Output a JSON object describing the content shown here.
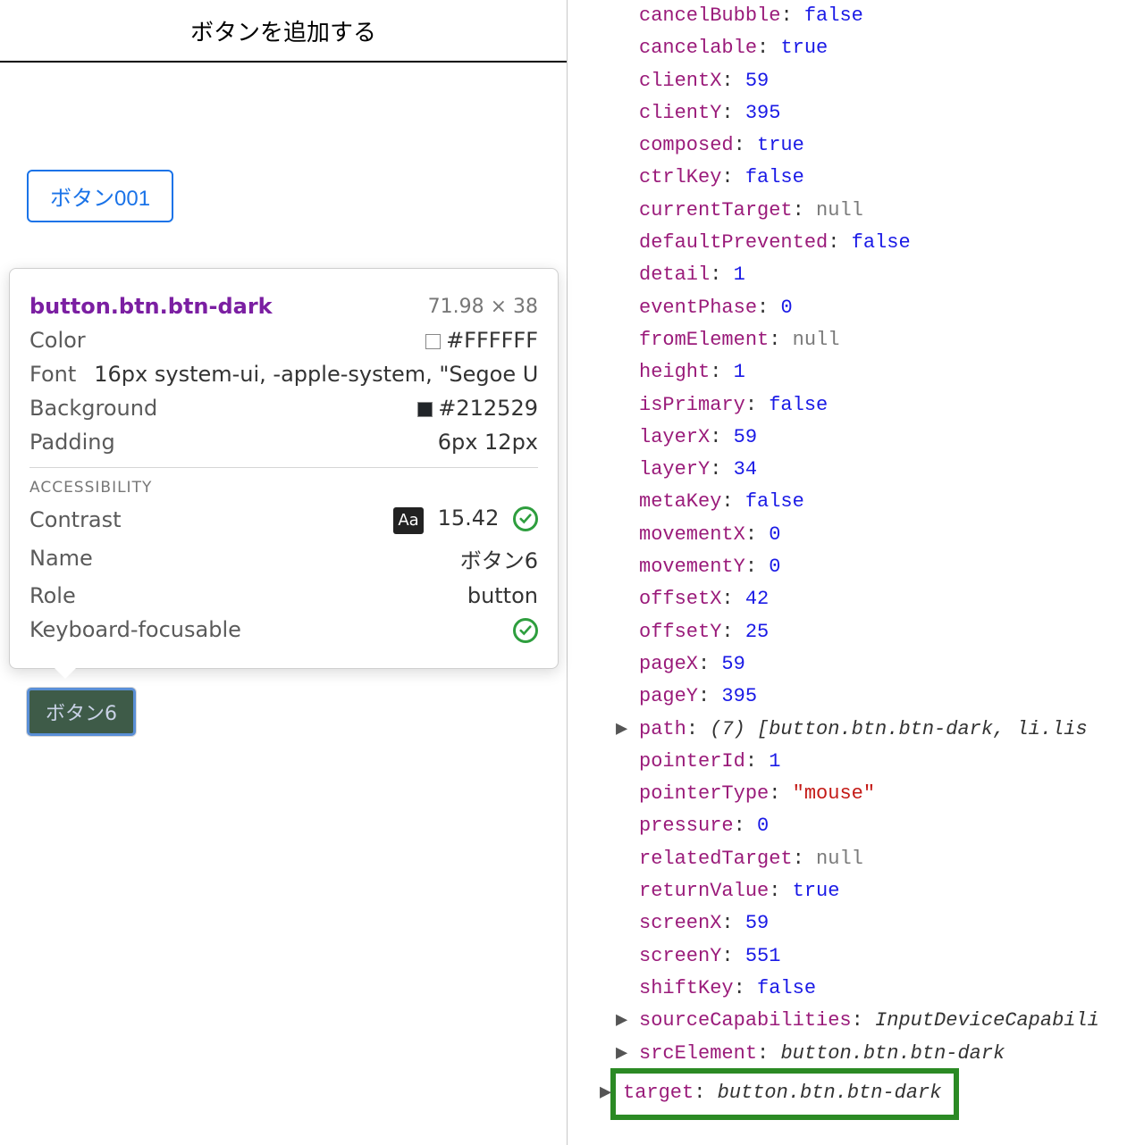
{
  "header": {
    "title": "ボタンを追加する"
  },
  "buttons": {
    "outline_label": "ボタン001",
    "dark_label": "ボタン6"
  },
  "inspector": {
    "selector": "button.btn.btn-dark",
    "dimensions": "71.98 × 38",
    "color_label": "Color",
    "color_value": "#FFFFFF",
    "font_label": "Font",
    "font_value": "16px system-ui, -apple-system, \"Segoe U...",
    "bg_label": "Background",
    "bg_value": "#212529",
    "padding_label": "Padding",
    "padding_value": "6px 12px",
    "a11y_title": "ACCESSIBILITY",
    "contrast_label": "Contrast",
    "contrast_badge": "Aa",
    "contrast_value": "15.42",
    "name_label": "Name",
    "name_value": "ボタン6",
    "role_label": "Role",
    "role_value": "button",
    "kb_label": "Keyboard-focusable"
  },
  "console": {
    "lines": [
      {
        "key": "cancelBubble",
        "val": "false",
        "type": "bool"
      },
      {
        "key": "cancelable",
        "val": "true",
        "type": "bool"
      },
      {
        "key": "clientX",
        "val": "59",
        "type": "num"
      },
      {
        "key": "clientY",
        "val": "395",
        "type": "num"
      },
      {
        "key": "composed",
        "val": "true",
        "type": "bool"
      },
      {
        "key": "ctrlKey",
        "val": "false",
        "type": "bool"
      },
      {
        "key": "currentTarget",
        "val": "null",
        "type": "null"
      },
      {
        "key": "defaultPrevented",
        "val": "false",
        "type": "bool"
      },
      {
        "key": "detail",
        "val": "1",
        "type": "num"
      },
      {
        "key": "eventPhase",
        "val": "0",
        "type": "num"
      },
      {
        "key": "fromElement",
        "val": "null",
        "type": "null"
      },
      {
        "key": "height",
        "val": "1",
        "type": "num"
      },
      {
        "key": "isPrimary",
        "val": "false",
        "type": "bool"
      },
      {
        "key": "layerX",
        "val": "59",
        "type": "num"
      },
      {
        "key": "layerY",
        "val": "34",
        "type": "num"
      },
      {
        "key": "metaKey",
        "val": "false",
        "type": "bool"
      },
      {
        "key": "movementX",
        "val": "0",
        "type": "num"
      },
      {
        "key": "movementY",
        "val": "0",
        "type": "num"
      },
      {
        "key": "offsetX",
        "val": "42",
        "type": "num"
      },
      {
        "key": "offsetY",
        "val": "25",
        "type": "num"
      },
      {
        "key": "pageX",
        "val": "59",
        "type": "num"
      },
      {
        "key": "pageY",
        "val": "395",
        "type": "num"
      },
      {
        "key": "path",
        "val": "(7) [button.btn.btn-dark, li.lis",
        "type": "inline",
        "expand": true
      },
      {
        "key": "pointerId",
        "val": "1",
        "type": "num"
      },
      {
        "key": "pointerType",
        "val": "\"mouse\"",
        "type": "str"
      },
      {
        "key": "pressure",
        "val": "0",
        "type": "num"
      },
      {
        "key": "relatedTarget",
        "val": "null",
        "type": "null"
      },
      {
        "key": "returnValue",
        "val": "true",
        "type": "bool"
      },
      {
        "key": "screenX",
        "val": "59",
        "type": "num"
      },
      {
        "key": "screenY",
        "val": "551",
        "type": "num"
      },
      {
        "key": "shiftKey",
        "val": "false",
        "type": "bool"
      },
      {
        "key": "sourceCapabilities",
        "val": "InputDeviceCapabili",
        "type": "inline",
        "expand": true
      },
      {
        "key": "srcElement",
        "val": "button.btn.btn-dark",
        "type": "inline",
        "expand": true
      }
    ],
    "target_key": "target",
    "target_val": "button.btn.btn-dark"
  }
}
